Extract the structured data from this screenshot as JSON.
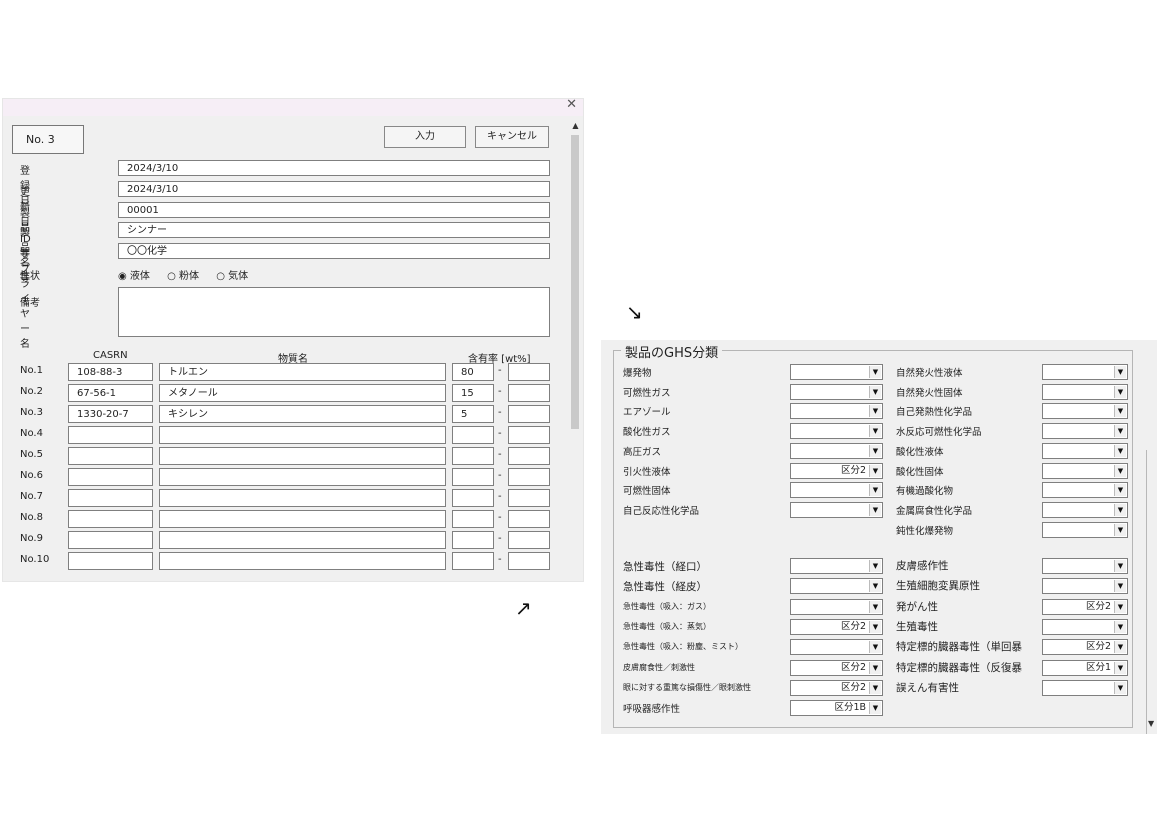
{
  "window": {
    "close_icon": "✕",
    "record_no": "No.  3",
    "buttons": {
      "input": "入力",
      "cancel": "キャンセル"
    }
  },
  "form": {
    "fields": [
      {
        "label": "登録日",
        "value": "2024/3/10"
      },
      {
        "label": "更新日",
        "value": "2024/3/10"
      },
      {
        "label": "製品ID等",
        "value": "00001"
      },
      {
        "label": "製品名等",
        "value": "シンナー"
      },
      {
        "label": "サプライヤー名",
        "value": "〇〇化学"
      }
    ],
    "state": {
      "label": "性状",
      "options": [
        "液体",
        "粉体",
        "気体"
      ],
      "selected": "液体"
    },
    "remarks": {
      "label": "備考",
      "value": ""
    }
  },
  "substances": {
    "headers": {
      "casrn": "CASRN",
      "name": "物質名",
      "content": "含有率 [wt%]"
    },
    "separator": "-",
    "rows": [
      {
        "no": "No.1",
        "casrn": "108-88-3",
        "name": "トルエン",
        "min": "80",
        "max": ""
      },
      {
        "no": "No.2",
        "casrn": "67-56-1",
        "name": "メタノール",
        "min": "15",
        "max": ""
      },
      {
        "no": "No.3",
        "casrn": "1330-20-7",
        "name": "キシレン",
        "min": "5",
        "max": ""
      },
      {
        "no": "No.4",
        "casrn": "",
        "name": "",
        "min": "",
        "max": ""
      },
      {
        "no": "No.5",
        "casrn": "",
        "name": "",
        "min": "",
        "max": ""
      },
      {
        "no": "No.6",
        "casrn": "",
        "name": "",
        "min": "",
        "max": ""
      },
      {
        "no": "No.7",
        "casrn": "",
        "name": "",
        "min": "",
        "max": ""
      },
      {
        "no": "No.8",
        "casrn": "",
        "name": "",
        "min": "",
        "max": ""
      },
      {
        "no": "No.9",
        "casrn": "",
        "name": "",
        "min": "",
        "max": ""
      },
      {
        "no": "No.10",
        "casrn": "",
        "name": "",
        "min": "",
        "max": ""
      }
    ]
  },
  "ghs": {
    "title": "製品のGHS分類",
    "physical_left": [
      {
        "label": "爆発物",
        "value": ""
      },
      {
        "label": "可燃性ガス",
        "value": ""
      },
      {
        "label": "エアゾール",
        "value": ""
      },
      {
        "label": "酸化性ガス",
        "value": ""
      },
      {
        "label": "高圧ガス",
        "value": ""
      },
      {
        "label": "引火性液体",
        "value": "区分2"
      },
      {
        "label": "可燃性固体",
        "value": ""
      },
      {
        "label": "自己反応性化学品",
        "value": ""
      }
    ],
    "physical_right": [
      {
        "label": "自然発火性液体",
        "value": ""
      },
      {
        "label": "自然発火性固体",
        "value": ""
      },
      {
        "label": "自己発熱性化学品",
        "value": ""
      },
      {
        "label": "水反応可燃性化学品",
        "value": ""
      },
      {
        "label": "酸化性液体",
        "value": ""
      },
      {
        "label": "酸化性固体",
        "value": ""
      },
      {
        "label": "有機過酸化物",
        "value": ""
      },
      {
        "label": "金属腐食性化学品",
        "value": ""
      },
      {
        "label": "鈍性化爆発物",
        "value": ""
      }
    ],
    "health_left": [
      {
        "label": "急性毒性（経口）",
        "value": "",
        "size": "big"
      },
      {
        "label": "急性毒性（経皮）",
        "value": "",
        "size": "big"
      },
      {
        "label": "急性毒性（吸入：ガス）",
        "value": "",
        "size": "small"
      },
      {
        "label": "急性毒性（吸入：蒸気）",
        "value": "区分2",
        "size": "small"
      },
      {
        "label": "急性毒性（吸入：粉塵、ミスト）",
        "value": "",
        "size": "small"
      },
      {
        "label": "皮膚腐食性／刺激性",
        "value": "区分2",
        "size": "small"
      },
      {
        "label": "眼に対する重篤な損傷性／眼刺激性",
        "value": "区分2",
        "size": "small"
      },
      {
        "label": "呼吸器感作性",
        "value": "区分1B",
        "size": ""
      }
    ],
    "health_right": [
      {
        "label": "皮膚感作性",
        "value": ""
      },
      {
        "label": "生殖細胞変異原性",
        "value": ""
      },
      {
        "label": "発がん性",
        "value": "区分2"
      },
      {
        "label": "生殖毒性",
        "value": ""
      },
      {
        "label": "特定標的臓器毒性（単回暴",
        "value": "区分2"
      },
      {
        "label": "特定標的臓器毒性（反復暴",
        "value": "区分1"
      },
      {
        "label": "誤えん有害性",
        "value": ""
      }
    ],
    "dropdown_icon": "▼",
    "scroll_down_icon": "▼"
  },
  "arrows": {
    "top": "↘",
    "bottom": "↗"
  },
  "scroll_up_icon": "▲"
}
